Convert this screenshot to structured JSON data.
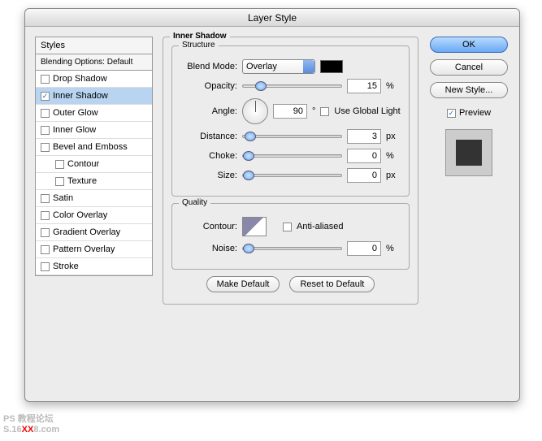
{
  "title": "Layer Style",
  "styles": {
    "header": "Styles",
    "blending": "Blending Options: Default",
    "items": [
      {
        "label": "Drop Shadow",
        "checked": false
      },
      {
        "label": "Inner Shadow",
        "checked": true,
        "selected": true
      },
      {
        "label": "Outer Glow",
        "checked": false
      },
      {
        "label": "Inner Glow",
        "checked": false
      },
      {
        "label": "Bevel and Emboss",
        "checked": false
      },
      {
        "label": "Contour",
        "checked": false,
        "indent": true
      },
      {
        "label": "Texture",
        "checked": false,
        "indent": true
      },
      {
        "label": "Satin",
        "checked": false
      },
      {
        "label": "Color Overlay",
        "checked": false
      },
      {
        "label": "Gradient Overlay",
        "checked": false
      },
      {
        "label": "Pattern Overlay",
        "checked": false
      },
      {
        "label": "Stroke",
        "checked": false
      }
    ]
  },
  "panel": {
    "title": "Inner Shadow",
    "structure": {
      "legend": "Structure",
      "blend_mode_label": "Blend Mode:",
      "blend_mode_value": "Overlay",
      "opacity_label": "Opacity:",
      "opacity_value": "15",
      "opacity_unit": "%",
      "angle_label": "Angle:",
      "angle_value": "90",
      "angle_unit": "°",
      "global_light": "Use Global Light",
      "distance_label": "Distance:",
      "distance_value": "3",
      "distance_unit": "px",
      "choke_label": "Choke:",
      "choke_value": "0",
      "choke_unit": "%",
      "size_label": "Size:",
      "size_value": "0",
      "size_unit": "px"
    },
    "quality": {
      "legend": "Quality",
      "contour_label": "Contour:",
      "anti_aliased": "Anti-aliased",
      "noise_label": "Noise:",
      "noise_value": "0",
      "noise_unit": "%"
    },
    "make_default": "Make Default",
    "reset_default": "Reset to Default"
  },
  "buttons": {
    "ok": "OK",
    "cancel": "Cancel",
    "new_style": "New Style...",
    "preview": "Preview"
  },
  "watermark": {
    "line1": "PS 教程论坛",
    "line2_a": "S.16",
    "line2_b": "XX",
    "line2_c": "8.com"
  }
}
